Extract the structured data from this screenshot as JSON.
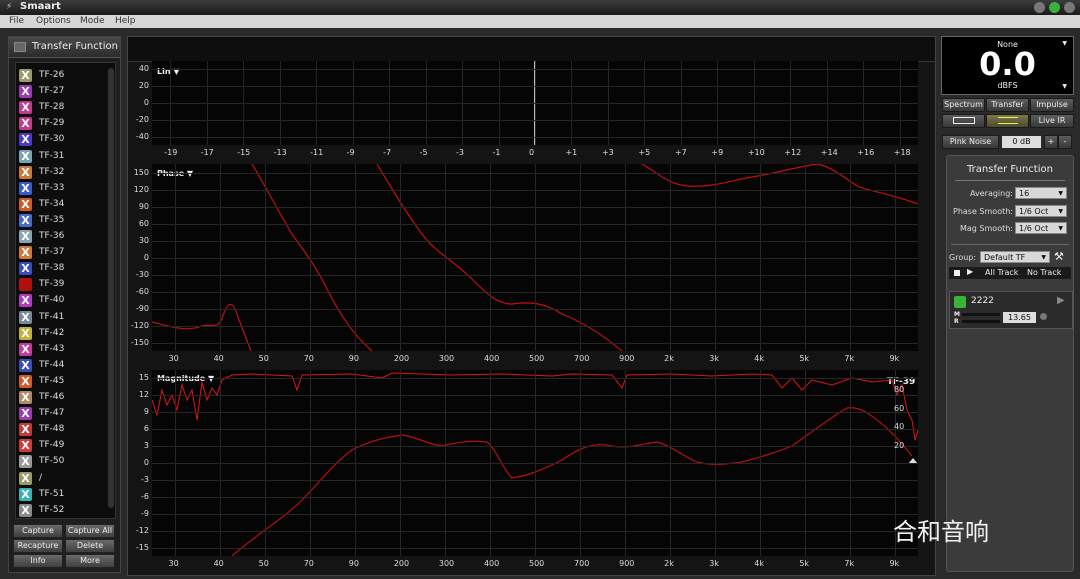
{
  "window": {
    "title": "Smaart"
  },
  "menu": [
    "File",
    "Options",
    "Mode",
    "Help"
  ],
  "left_panel": {
    "header": "Transfer Function",
    "items": [
      {
        "label": "TF-26",
        "color": "#9a9a6a"
      },
      {
        "label": "TF-27",
        "color": "#9a3bb3"
      },
      {
        "label": "TF-28",
        "color": "#c23a8a"
      },
      {
        "label": "TF-29",
        "color": "#c23a8a"
      },
      {
        "label": "TF-30",
        "color": "#4a3acb"
      },
      {
        "label": "TF-31",
        "color": "#7aa6b3"
      },
      {
        "label": "TF-32",
        "color": "#c97a3a"
      },
      {
        "label": "TF-33",
        "color": "#3a5bcb"
      },
      {
        "label": "TF-34",
        "color": "#cf5a2a"
      },
      {
        "label": "TF-35",
        "color": "#4a6acb"
      },
      {
        "label": "TF-36",
        "color": "#8aa6b3"
      },
      {
        "label": "TF-37",
        "color": "#d07a3a"
      },
      {
        "label": "TF-38",
        "color": "#3a4bbb"
      },
      {
        "label": "TF-39",
        "color": "#b01010"
      },
      {
        "label": "TF-40",
        "color": "#b03ac0"
      },
      {
        "label": "TF-41",
        "color": "#7a8a9a"
      },
      {
        "label": "TF-42",
        "color": "#c2b03a"
      },
      {
        "label": "TF-43",
        "color": "#c23a9a"
      },
      {
        "label": "TF-44",
        "color": "#3a4bbb"
      },
      {
        "label": "TF-45",
        "color": "#cf5a2a"
      },
      {
        "label": "TF-46",
        "color": "#b08a6a"
      },
      {
        "label": "TF-47",
        "color": "#9a3bb3"
      },
      {
        "label": "TF-48",
        "color": "#c23a3a"
      },
      {
        "label": "TF-49",
        "color": "#cf3a3a"
      },
      {
        "label": "TF-50",
        "color": "#9a9a9a"
      },
      {
        "label": "/",
        "color": "#9a9a6a"
      },
      {
        "label": "TF-51",
        "color": "#3ab3b3"
      },
      {
        "label": "TF-52",
        "color": "#8a8a8a"
      }
    ],
    "buttons": [
      "Capture",
      "Capture All",
      "Recapture",
      "Delete",
      "Info",
      "More"
    ]
  },
  "lin_graph": {
    "mode_label": "Lin ▼",
    "y_ticks": [
      "40",
      "20",
      "0",
      "-20",
      "-40"
    ],
    "x_ticks": [
      "-19",
      "-17",
      "-15",
      "-13",
      "-11",
      "-9",
      "-7",
      "-5",
      "-3",
      "-1",
      "0",
      "+1",
      "+3",
      "+5",
      "+7",
      "+9",
      "+10",
      "+12",
      "+14",
      "+16",
      "+18"
    ]
  },
  "phase_graph": {
    "mode_label": "Phase ▼",
    "y_ticks": [
      "150",
      "120",
      "90",
      "60",
      "30",
      "0",
      "-30",
      "-60",
      "-90",
      "-120",
      "-150"
    ],
    "x_ticks": [
      "30",
      "40",
      "50",
      "70",
      "90",
      "200",
      "300",
      "400",
      "500",
      "700",
      "900",
      "2k",
      "3k",
      "4k",
      "5k",
      "7k",
      "9k"
    ]
  },
  "magnitude_graph": {
    "mode_label": "Magnitude ▼",
    "trace_label": "TF-39",
    "y_ticks": [
      "15",
      "12",
      "9",
      "6",
      "3",
      "0",
      "-3",
      "-6",
      "-9",
      "-12",
      "-15"
    ],
    "coherence_ticks": [
      "80",
      "60",
      "40",
      "20"
    ],
    "x_ticks": [
      "30",
      "40",
      "50",
      "70",
      "90",
      "200",
      "300",
      "400",
      "500",
      "700",
      "900",
      "2k",
      "3k",
      "4k",
      "5k",
      "7k",
      "9k"
    ]
  },
  "right_panel": {
    "meter": {
      "source": "None",
      "value": "0.0",
      "unit": "dBFS"
    },
    "mode_tabs": [
      "Spectrum",
      "Transfer",
      "Impulse"
    ],
    "live_ir": "Live IR",
    "pink_noise": {
      "label": "Pink Noise",
      "level": "0 dB",
      "plus": "+",
      "minus": "-"
    },
    "tf_section": {
      "title": "Transfer Function",
      "averaging": {
        "label": "Averaging:",
        "value": "16"
      },
      "phase_smooth": {
        "label": "Phase Smooth:",
        "value": "1/6 Oct"
      },
      "mag_smooth": {
        "label": "Mag Smooth:",
        "value": "1/6 Oct"
      },
      "group": {
        "label": "Group:",
        "value": "Default TF"
      },
      "track_all": "All Track",
      "track_none": "No Track",
      "engine": {
        "name": "2222",
        "delay": "13.65",
        "m_label": "M",
        "r_label": "R"
      }
    }
  },
  "watermark": "合和音响"
}
